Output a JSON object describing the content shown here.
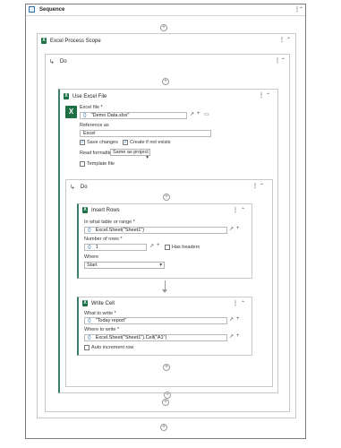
{
  "sequence": {
    "title": "Sequence"
  },
  "process_scope": {
    "title": "Excel Process Scope"
  },
  "do1": {
    "title": "Do"
  },
  "use_excel": {
    "title": "Use Excel File",
    "file_label": "Excel file *",
    "file_value": "\"Demo Data.xlsx\"",
    "ref_label": "Reference as",
    "ref_value": "Excel",
    "save_changes": "Save changes",
    "create_if_not_exists": "Create if not exists",
    "read_formatting_label": "Read formatting",
    "read_formatting_value": "Same as project",
    "template_file": "Template file"
  },
  "do2": {
    "title": "Do"
  },
  "insert_rows": {
    "title": "Insert Rows",
    "range_label": "In what table or range *",
    "range_value": "Excel.Sheet(\"Sheet1\")",
    "count_label": "Number of rows *",
    "count_value": "1",
    "has_headers": "Has headers",
    "where_label": "Where",
    "where_value": "Start"
  },
  "write_cell": {
    "title": "Write Cell",
    "what_label": "What to write *",
    "what_value": "\"Today report\"",
    "where_label": "Where to write *",
    "where_value": "Excel.Sheet(\"Sheet1\").Cell(\"A1\")",
    "auto_increment": "Auto increment row"
  },
  "symbols": {
    "brace": "{}",
    "plus": "+",
    "dots": "⋮",
    "collapse": "⌃",
    "expand": "↗",
    "do_arrow": "↳",
    "check": "✓",
    "dropdown": "▾",
    "folder": "▭"
  },
  "colors": {
    "excel_green": "#1d7044",
    "border": "#c8c8c8",
    "frame": "#7c7c7c"
  }
}
